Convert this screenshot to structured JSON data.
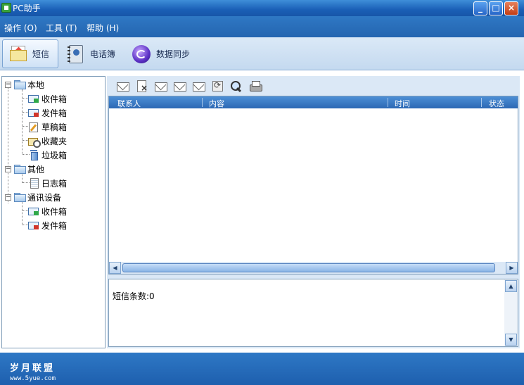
{
  "window": {
    "title": "PC助手",
    "controls": {
      "minimize": "_",
      "maximize": "□",
      "close": "×"
    }
  },
  "menu": {
    "items": [
      {
        "label": "操作 (O)"
      },
      {
        "label": "工具 (T)"
      },
      {
        "label": "帮助 (H)"
      }
    ]
  },
  "toolbar": {
    "tabs": [
      {
        "label": "短信",
        "icon": "message-envelope-icon",
        "active": true
      },
      {
        "label": "电话簿",
        "icon": "phonebook-icon",
        "active": false
      },
      {
        "label": "数据同步",
        "icon": "sync-globe-icon",
        "active": false
      }
    ]
  },
  "tree": {
    "groups": [
      {
        "label": "本地",
        "expander": "−",
        "children": [
          {
            "label": "收件箱",
            "icon": "inbox-icon"
          },
          {
            "label": "发件箱",
            "icon": "outbox-icon"
          },
          {
            "label": "草稿箱",
            "icon": "draft-icon"
          },
          {
            "label": "收藏夹",
            "icon": "favorites-icon"
          },
          {
            "label": "垃圾箱",
            "icon": "trash-icon"
          }
        ]
      },
      {
        "label": "其他",
        "expander": "−",
        "children": [
          {
            "label": "日志箱",
            "icon": "log-icon"
          }
        ]
      },
      {
        "label": "通讯设备",
        "expander": "−",
        "children": [
          {
            "label": "收件箱",
            "icon": "inbox-icon"
          },
          {
            "label": "发件箱",
            "icon": "outbox-icon"
          }
        ]
      }
    ]
  },
  "message_toolbar": {
    "icons": [
      "new-message-icon",
      "delete-message-icon",
      "reply-icon",
      "forward-icon",
      "send-icon",
      "refresh-icon",
      "search-icon",
      "print-icon"
    ]
  },
  "message_list": {
    "columns": [
      "联系人",
      "内容",
      "时间",
      "状态"
    ],
    "rows": []
  },
  "detail": {
    "count_text": "短信条数:0"
  },
  "footer": {
    "logo_text": "岁月联盟",
    "logo_url": "www.5yue.com"
  },
  "colors": {
    "titlebar": "#1a5fb6",
    "menubar": "#2f78c4",
    "list_header": "#3c7cc8"
  }
}
